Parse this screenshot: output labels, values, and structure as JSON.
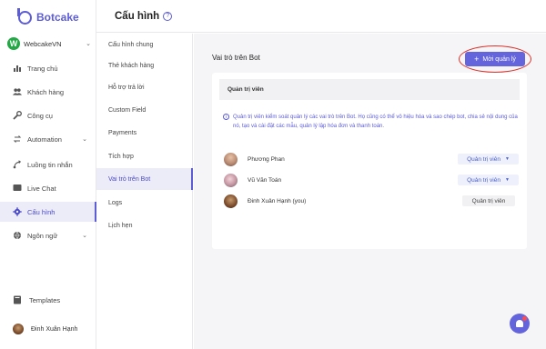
{
  "brand": {
    "name": "Botcake",
    "color": "#5c5cd6"
  },
  "workspace": {
    "badge": "W",
    "name": "WebcakeVN"
  },
  "nav": [
    {
      "icon": "bar-chart-icon",
      "label": "Trang chủ"
    },
    {
      "icon": "users-icon",
      "label": "Khách hàng"
    },
    {
      "icon": "wrench-icon",
      "label": "Công cụ"
    },
    {
      "icon": "automation-icon",
      "label": "Automation"
    },
    {
      "icon": "flow-icon",
      "label": "Luồng tin nhắn"
    },
    {
      "icon": "chat-icon",
      "label": "Live Chat"
    },
    {
      "icon": "gear-icon",
      "label": "Cấu hình"
    },
    {
      "icon": "globe-icon",
      "label": "Ngôn ngữ"
    }
  ],
  "templates": {
    "label": "Templates"
  },
  "user": {
    "name": "Đinh Xuân Hạnh"
  },
  "header": {
    "title": "Cấu hình"
  },
  "submenu": [
    "Cấu hình chung",
    "Thẻ khách hàng",
    "Hỗ trợ trả lời",
    "Custom Field",
    "Payments",
    "Tích hợp",
    "Vai trò trên Bot",
    "Logs",
    "Lịch hẹn"
  ],
  "content": {
    "section_title": "Vai trò trên Bot",
    "invite_button": "Mời quản lý",
    "card_header": "Quản trị viên",
    "info_text": "Quản trị viên kiểm soát quản lý các vai trò trên Bot. Họ cũng có thể vô hiệu hóa và sao chép bot, chia sẻ nội dung của nó, tạo và cài đặt các mẫu, quản lý lập hóa đơn và thanh toán.",
    "members": [
      {
        "name": "Phương Phan",
        "role": "Quản trị viên"
      },
      {
        "name": "Vũ Văn Toán",
        "role": "Quản trị viên"
      },
      {
        "name": "Đinh Xuân Hạnh (you)",
        "role": "Quản trị viên"
      }
    ]
  }
}
